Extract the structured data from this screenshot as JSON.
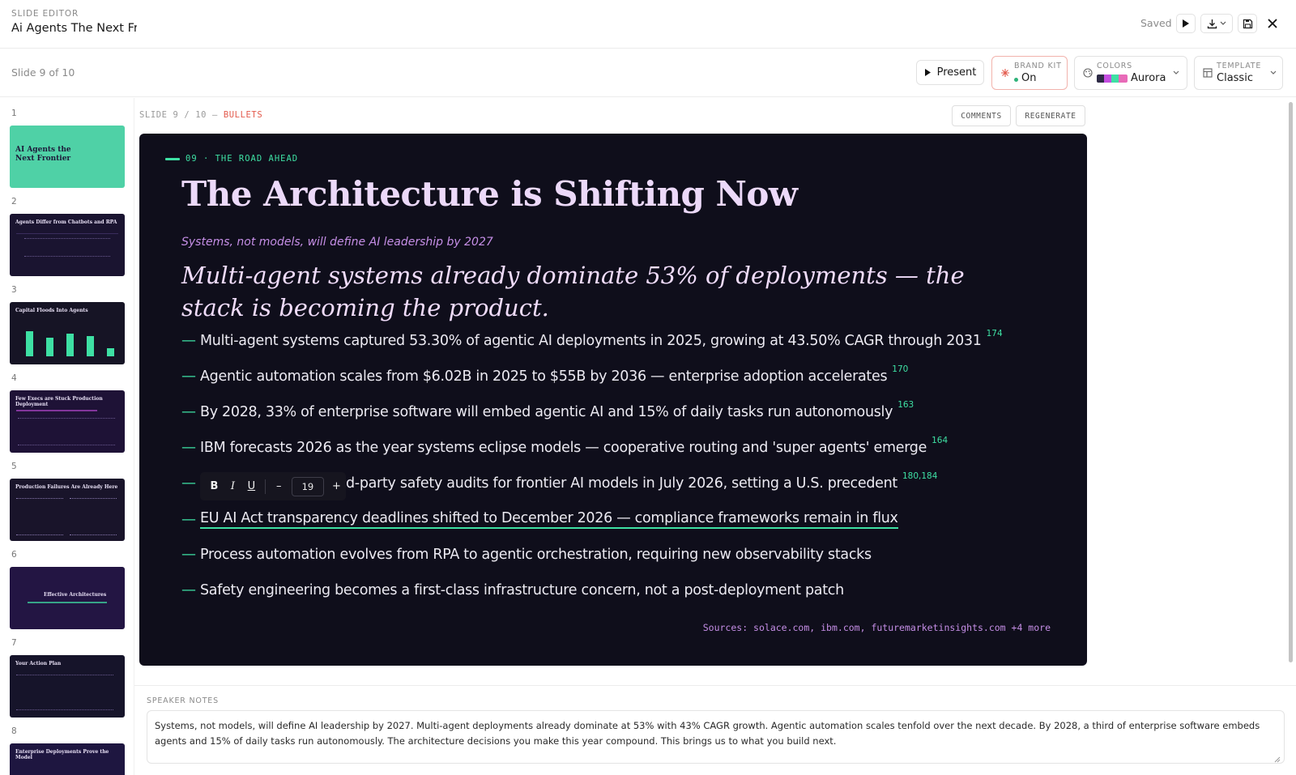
{
  "header": {
    "app_label": "SLIDE EDITOR",
    "doc_title": "Ai Agents The Next Frontier",
    "saved_status": "Saved"
  },
  "toolbar": {
    "slide_counter": "Slide 9 of 10",
    "present_label": "Present",
    "brand_kit": {
      "label": "BRAND KIT",
      "value": "On",
      "status_color": "#2fb37a"
    },
    "colors": {
      "label": "COLORS",
      "value": "Aurora",
      "swatches": [
        "#2d2a45",
        "#c44de0",
        "#3ee0a4",
        "#e86ab8"
      ]
    },
    "template": {
      "label": "TEMPLATE",
      "value": "Classic"
    }
  },
  "sidebar": {
    "thumbnails": [
      {
        "number": "1",
        "title": "AI Agents the Next Frontier",
        "bg": "#4fd1a6"
      },
      {
        "number": "2",
        "title": "Agents Differ from Chatbots and RPA",
        "bg": "#1a1430"
      },
      {
        "number": "3",
        "title": "Capital Floods Into Agents",
        "bg": "#161425"
      },
      {
        "number": "4",
        "title": "Few Execs are Stuck Production Deployment",
        "bg": "#1e1236"
      },
      {
        "number": "5",
        "title": "Production Failures Are Already Here",
        "bg": "#19142a"
      },
      {
        "number": "6",
        "title": "Effective Architectures",
        "bg": "#231543"
      },
      {
        "number": "7",
        "title": "Your Action Plan",
        "bg": "#16142a"
      },
      {
        "number": "8",
        "title": "Enterprise Deployments Prove the Model",
        "bg": "#1e1640"
      }
    ]
  },
  "editor": {
    "breadcrumb_prefix": "SLIDE 9 / 10 —",
    "breadcrumb_type": "BULLETS",
    "comments_label": "COMMENTS",
    "regenerate_label": "REGENERATE"
  },
  "slide": {
    "eyebrow": "09 · THE ROAD AHEAD",
    "title": "The Architecture is Shifting Now",
    "subtitle": "Systems, not models, will define AI leadership by 2027",
    "lead": "Multi-agent systems already dominate 53% of deployments — the stack is becoming the product.",
    "bullets": [
      {
        "text": "Multi-agent systems captured 53.30% of agentic AI deployments in 2025, growing at 43.50% CAGR through 2031",
        "cite": "174"
      },
      {
        "text": "Agentic automation scales from $6.02B in 2025 to $55B by 2036 — enterprise adoption accelerates",
        "cite": "170"
      },
      {
        "text": "By 2028, 33% of enterprise software will embed agentic AI and 15% of daily tasks run autonomously",
        "cite": "163"
      },
      {
        "text": "IBM forecasts 2026 as the year systems eclipse models — cooperative routing and 'super agents' emerge",
        "cite": "164"
      },
      {
        "text": "d-party safety audits for frontier AI models in July 2026, setting a U.S. precedent",
        "cite": "180,184"
      },
      {
        "text": "EU AI Act transparency deadlines shifted to December 2026 — compliance frameworks remain in flux",
        "cite": ""
      },
      {
        "text": "Process automation evolves from RPA to agentic orchestration, requiring new observability stacks",
        "cite": ""
      },
      {
        "text": "Safety engineering becomes a first-class infrastructure concern, not a post-deployment patch",
        "cite": ""
      }
    ],
    "sources": "Sources: solace.com, ibm.com, futuremarketinsights.com +4 more"
  },
  "format_toolbar": {
    "bold": "B",
    "italic": "I",
    "underline": "U",
    "decrease": "–",
    "font_size": "19",
    "increase": "+"
  },
  "notes": {
    "label": "SPEAKER NOTES",
    "text": "Systems, not models, will define AI leadership by 2027. Multi-agent deployments already dominate at 53% with 43% CAGR growth. Agentic automation scales tenfold over the next decade. By 2028, a third of enterprise software embeds agents and 15% of daily tasks run autonomously. The architecture decisions you make this year compound. This brings us to what you build next."
  }
}
